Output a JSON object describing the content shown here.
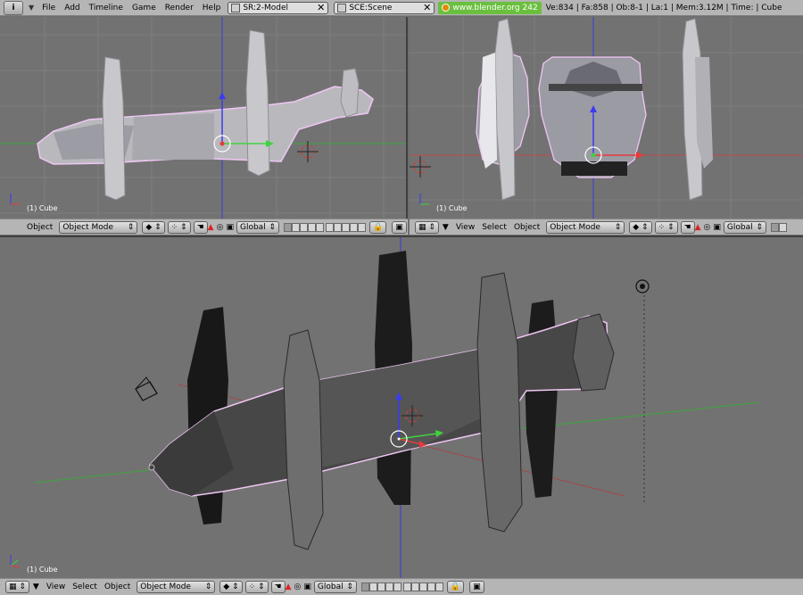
{
  "topbar": {
    "menus": [
      "File",
      "Add",
      "Timeline",
      "Game",
      "Render",
      "Help"
    ],
    "screen_field": "SR:2-Model",
    "scene_field": "SCE:Scene",
    "url": "www.blender.org 242",
    "stats": "Ve:834 | Fa:858 | Ob:8-1 | La:1  | Mem:3.12M  | Time: | Cube"
  },
  "viewports": {
    "front": {
      "object_label": "(1) Cube"
    },
    "side": {
      "object_label": "(1) Cube"
    },
    "perspective": {
      "object_label": "(1) Cube"
    }
  },
  "header": {
    "object_menu": "Object",
    "view_menu": "View",
    "select_menu": "Select",
    "mode": "Object Mode",
    "orientation": "Global",
    "arrows": "⇕"
  },
  "colors": {
    "background": "#727272",
    "header": "#b5b5b5",
    "selection_outline": "#f0c6f5",
    "axis_x": "#e63b3b",
    "axis_y": "#3fd23f",
    "axis_z": "#3b3bf0",
    "url_badge": "#6abf3f"
  }
}
